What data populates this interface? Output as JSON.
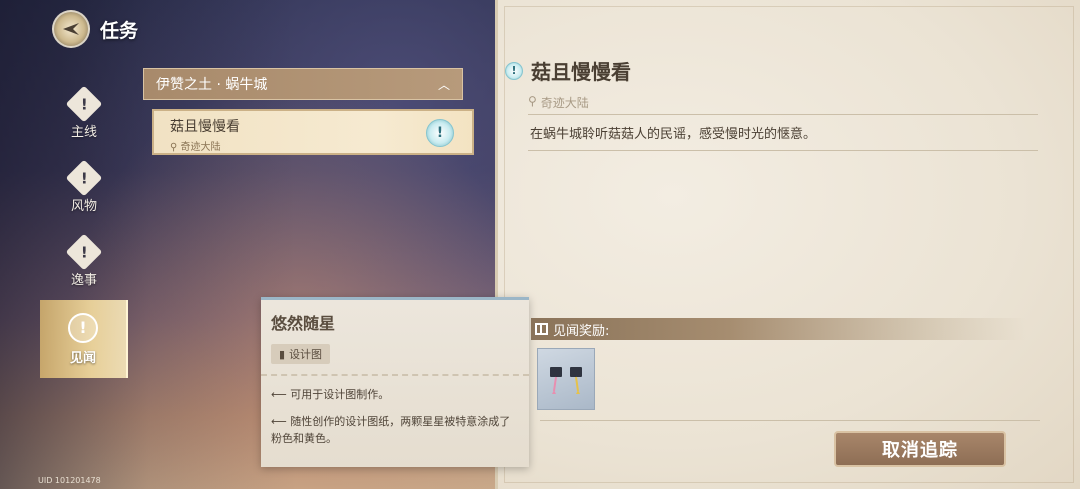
{
  "header": {
    "title": "任务"
  },
  "sidebar": {
    "items": [
      {
        "label": "主线",
        "icon": "main-quest-icon"
      },
      {
        "label": "风物",
        "icon": "lore-icon"
      },
      {
        "label": "逸事",
        "icon": "anecdote-icon"
      },
      {
        "label": "见闻",
        "icon": "exploration-icon",
        "active": true
      }
    ]
  },
  "quest_list": {
    "region": "伊赞之土 · 蜗牛城",
    "quest": {
      "title": "菇且慢慢看",
      "location": "奇迹大陆"
    }
  },
  "tooltip": {
    "title": "悠然随星",
    "tag": "设计图",
    "lines": [
      "可用于设计图制作。",
      "随性创作的设计图纸，两颗星星被特意涂成了粉色和黄色。"
    ]
  },
  "detail": {
    "title": "菇且慢慢看",
    "location": "奇迹大陆",
    "description": "在蜗牛城聆听菇菇人的民谣，感受慢时光的惬意。",
    "reward_label": "见闻奖励:",
    "cancel_label": "取消追踪"
  },
  "uid": "UID 101201478",
  "colors": {
    "accent_gold": "#e9d39f",
    "badge_cyan": "#6fb5c0",
    "button_brown": "#9a7a5f"
  }
}
